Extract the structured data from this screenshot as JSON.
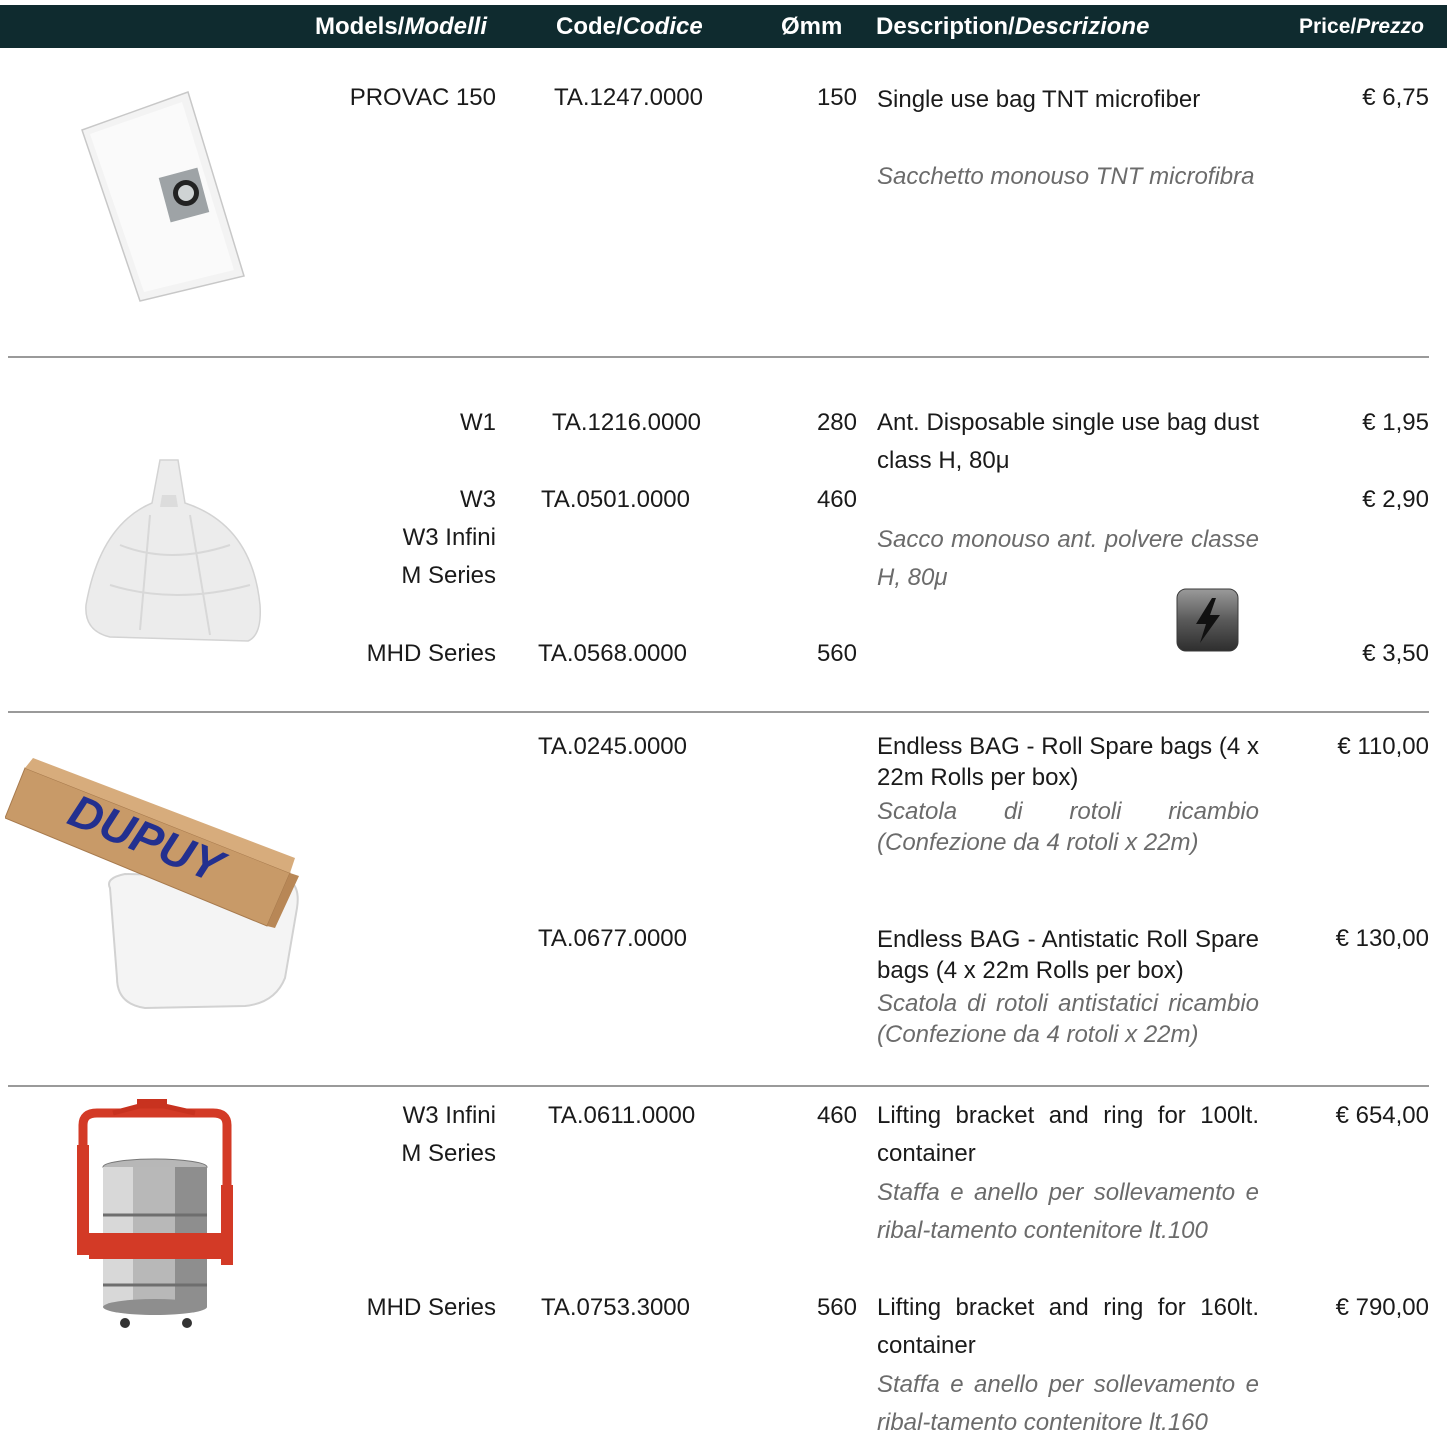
{
  "header": {
    "models": "Models/",
    "models_it": "Modelli",
    "code": "Code/",
    "code_it": "Codice",
    "diam": "Ømm",
    "desc": "Description/",
    "desc_it": "Descrizione",
    "price": "Price/",
    "price_it": "Prezzo"
  },
  "rows": [
    {
      "models": [
        "PROVAC 150"
      ],
      "code": "TA.1247.0000",
      "diam": "150",
      "desc_en": "Single use bag TNT microfiber",
      "desc_it": "Sacchetto monouso TNT microfibra",
      "price": "€ 6,75"
    },
    {
      "models": [
        "W1",
        "W3",
        "W3 Infini",
        "M Series",
        "MHD Series"
      ],
      "codes": [
        "TA.1216.0000",
        "TA.0501.0000",
        "TA.0568.0000"
      ],
      "diams": [
        "280",
        "460",
        "560"
      ],
      "desc_en": "Ant. Disposable single use bag dust class H, 80μ",
      "desc_it": "Sacco monouso ant. polvere classe H, 80μ",
      "prices": [
        "€ 1,95",
        "€ 2,90",
        "€ 3,50"
      ],
      "icon": "lightning-icon"
    },
    {
      "code_a": "TA.0245.0000",
      "desc_a_en": "Endless BAG - Roll Spare bags (4 x 22m Rolls per box)",
      "desc_a_it": "Scatola di rotoli ricambio (Confezione da 4 rotoli x 22m)",
      "price_a": "€ 110,00",
      "code_b": "TA.0677.0000",
      "desc_b_en": "Endless BAG - Antistatic Roll Spare bags (4 x 22m Rolls per box)",
      "desc_b_it": "Scatola di rotoli antistatici ricambio (Confezione da 4 rotoli x 22m)",
      "price_b": "€ 130,00",
      "box_logo": "DUPUY"
    },
    {
      "models_a": [
        "W3 Infini",
        "M Series"
      ],
      "code_a": "TA.0611.0000",
      "diam_a": "460",
      "desc_a_en": "Lifting bracket and ring for 100lt. container",
      "desc_a_it": "Staffa e anello per sollevamento e ribal-tamento contenitore lt.100",
      "price_a": "€ 654,00",
      "models_b": [
        "MHD Series"
      ],
      "code_b": "TA.0753.3000",
      "diam_b": "560",
      "desc_b_en": "Lifting bracket and ring for 160lt. container",
      "desc_b_it": "Staffa e anello per sollevamento e ribal-tamento contenitore lt.160",
      "price_b": "€ 790,00"
    }
  ],
  "colors": {
    "header_bg": "#0f2b2f",
    "separator": "#9a9a9a",
    "italic_text": "#6b6b6b"
  }
}
